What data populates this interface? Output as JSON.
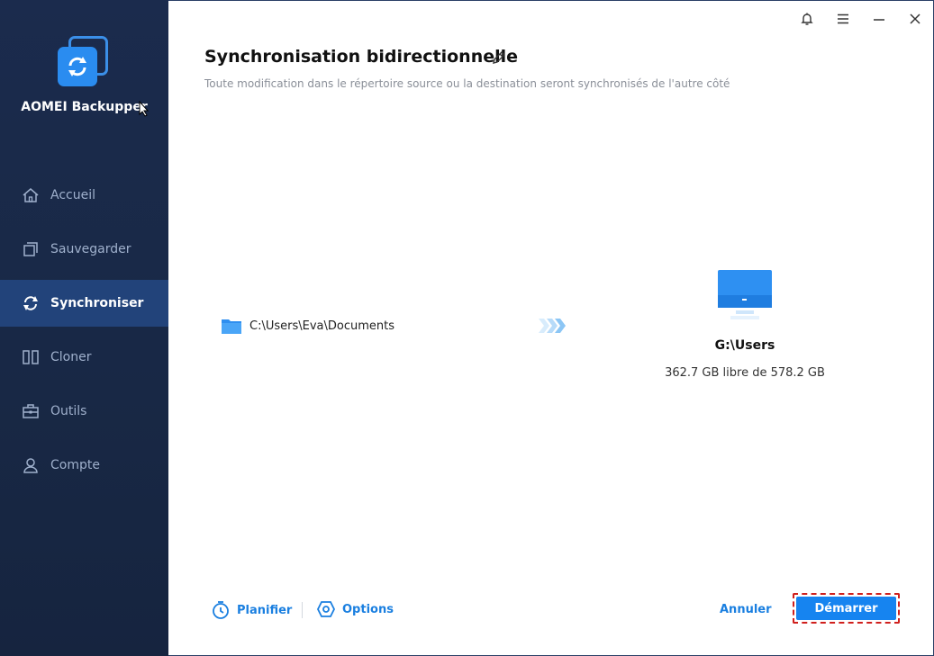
{
  "app": {
    "name": "AOMEI Backupper"
  },
  "sidebar": {
    "items": [
      {
        "label": "Accueil",
        "icon": "home-icon"
      },
      {
        "label": "Sauvegarder",
        "icon": "backup-icon"
      },
      {
        "label": "Synchroniser",
        "icon": "sync-icon",
        "active": true
      },
      {
        "label": "Cloner",
        "icon": "clone-icon"
      },
      {
        "label": "Outils",
        "icon": "toolbox-icon"
      },
      {
        "label": "Compte",
        "icon": "user-icon"
      }
    ]
  },
  "window": {
    "controls": [
      "bell-icon",
      "menu-icon",
      "minimize-icon",
      "close-icon"
    ]
  },
  "header": {
    "title": "Synchronisation bidirectionnelle",
    "subtitle": "Toute modification dans le répertoire source ou la destination seront synchronisés de l'autre côté"
  },
  "source": {
    "path": "C:\\Users\\Eva\\Documents",
    "icon": "folder-icon"
  },
  "destination": {
    "name": "G:\\Users",
    "free": "362.7 GB libre de 578.2 GB",
    "icon": "monitor-icon"
  },
  "footer": {
    "schedule_label": "Planifier",
    "options_label": "Options",
    "cancel_label": "Annuler",
    "start_label": "Démarrer"
  },
  "colors": {
    "accent": "#1684f0",
    "sidebar": "#1b2b4d",
    "active_nav": "#22437a",
    "highlight": "#d0201d"
  }
}
